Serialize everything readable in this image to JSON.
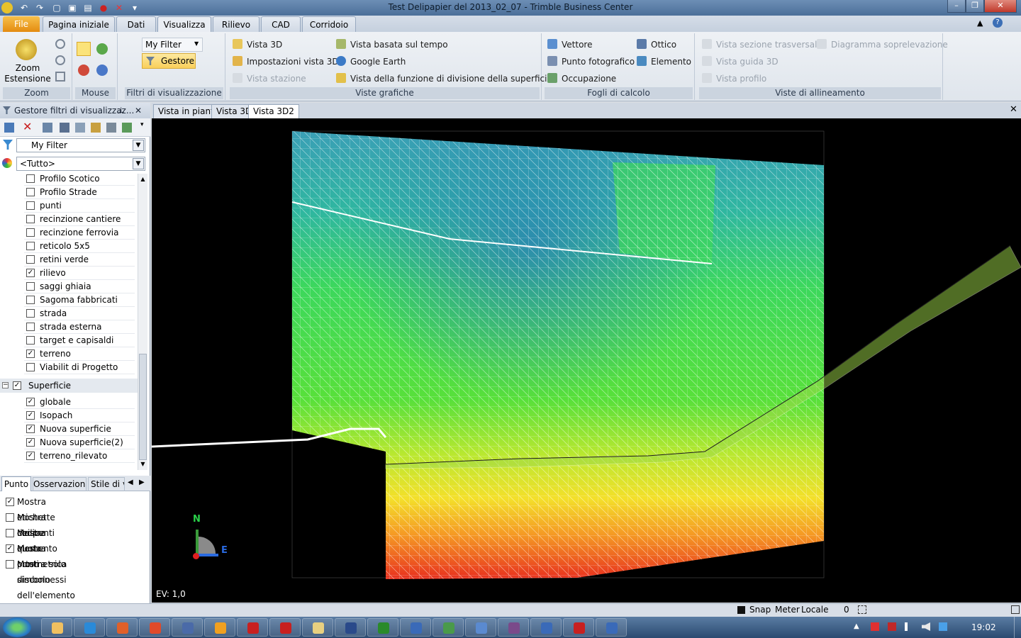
{
  "window": {
    "title": "Test Delipapier del 2013_02_07 - Trimble Business Center"
  },
  "ribbon_tabs": [
    {
      "label": "File"
    },
    {
      "label": "Pagina iniziale"
    },
    {
      "label": "Dati"
    },
    {
      "label": "Visualizza"
    },
    {
      "label": "Rilievo"
    },
    {
      "label": "CAD"
    },
    {
      "label": "Corridoio"
    }
  ],
  "ribbon": {
    "zoom": {
      "label": "Zoom",
      "button_label": "Zoom\nEstensione"
    },
    "mouse": {
      "label": "Mouse"
    },
    "filtri": {
      "label": "Filtri di visualizzazione",
      "filter_value": "My Filter",
      "gestore": "Gestore"
    },
    "viste_grafiche": {
      "label": "Viste grafiche",
      "items": [
        "Vista 3D",
        "Impostazioni vista 3D",
        "Vista stazione",
        "Vista basata sul tempo",
        "Google Earth",
        "Vista della funzione di divisione della superficie"
      ]
    },
    "fogli": {
      "label": "Fogli di calcolo",
      "items": [
        "Vettore",
        "Punto fotografico",
        "Occupazione",
        "Ottico",
        "Elemento"
      ]
    },
    "allineamento": {
      "label": "Viste di allineamento",
      "items": [
        "Vista sezione trasversale",
        "Vista guida 3D",
        "Vista profilo",
        "Diagramma soprelevazione"
      ]
    }
  },
  "panel": {
    "title": "Gestore filtri di visualizzaz...",
    "filter_select": "My Filter",
    "type_select": "<Tutto>",
    "layers": [
      {
        "label": "Profilo Scotico",
        "checked": false
      },
      {
        "label": "Profilo Strade",
        "checked": false
      },
      {
        "label": "punti",
        "checked": false
      },
      {
        "label": "recinzione cantiere",
        "checked": false
      },
      {
        "label": "recinzione ferrovia",
        "checked": false
      },
      {
        "label": "reticolo 5x5",
        "checked": false
      },
      {
        "label": "retini verde",
        "checked": false
      },
      {
        "label": "rilievo",
        "checked": true
      },
      {
        "label": "saggi ghiaia",
        "checked": false
      },
      {
        "label": "Sagoma fabbricati",
        "checked": false
      },
      {
        "label": "strada",
        "checked": false
      },
      {
        "label": "strada esterna",
        "checked": false
      },
      {
        "label": "target e capisaldi",
        "checked": false
      },
      {
        "label": "terreno",
        "checked": true
      },
      {
        "label": "Viabilit  di Progetto",
        "checked": false
      }
    ],
    "group": {
      "label": "Superficie",
      "checked": true
    },
    "surfaces": [
      {
        "label": "globale",
        "checked": true
      },
      {
        "label": "Isopach",
        "checked": true
      },
      {
        "label": "Nuova superficie",
        "checked": true
      },
      {
        "label": "Nuova superficie(2)",
        "checked": true
      },
      {
        "label": "terreno_rilevato",
        "checked": true
      }
    ],
    "bottom_tabs": [
      "Punto",
      "Osservazioni",
      "Stile di vi"
    ],
    "options": [
      {
        "label": "Mostra etichette dei punti",
        "checked": true
      },
      {
        "label": "Mostra codice elemento",
        "checked": false
      },
      {
        "label": "Mostra quota ortometrica",
        "checked": false
      },
      {
        "label": "Mostra punti disconnessi",
        "checked": true
      },
      {
        "label": "Mostra solo simbolo dell'elemento",
        "checked": false
      }
    ]
  },
  "view_tabs": [
    "Vista in pianta",
    "Vista 3D",
    "Vista 3D2"
  ],
  "viewport": {
    "ev_label": "EV: 1,0",
    "north": "N",
    "east": "E"
  },
  "status": {
    "snap": "Snap",
    "units": "Meter",
    "coords": "Locale",
    "count": "0"
  },
  "taskbar": {
    "clock": "19:02"
  },
  "colors": {
    "ribbon_active": "#e9edf3",
    "file_tab": "#e48b10",
    "viewport_bg": "#000000"
  }
}
